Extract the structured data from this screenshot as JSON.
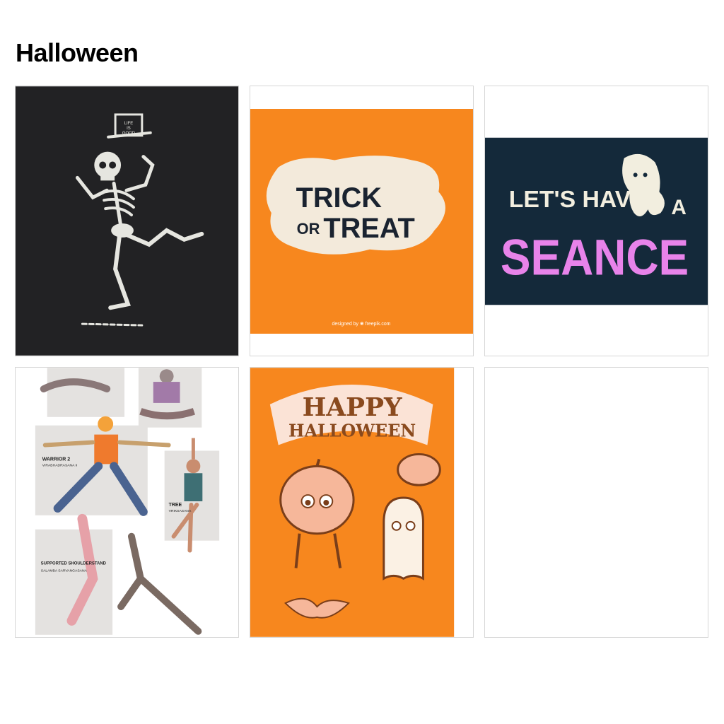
{
  "page": {
    "title": "Halloween"
  },
  "gallery": {
    "tiles": [
      {
        "artwork": "dancing-skeleton-top-hat",
        "hat_text": [
          "LIFE",
          "IS",
          "GOOD"
        ],
        "background": "#222224"
      },
      {
        "artwork": "trick-or-treat-lettering",
        "line1": "TRICK",
        "line2a": "OR",
        "line2b": "TREAT",
        "credit": "designed by ❀ freepik.com",
        "background": "#f7871e"
      },
      {
        "artwork": "lets-have-a-seance-ghost",
        "line1": "LET'S HAVE",
        "word_a": "A",
        "line2": "SEANCE",
        "background": "#14293a",
        "accent": "#e883ea"
      },
      {
        "artwork": "zombie-yoga-poses",
        "labels": [
          {
            "name": "WARRIOR 2",
            "sub": "VIRABHADRASANA II"
          },
          {
            "name": "TREE",
            "sub": "VRIKSASANA"
          },
          {
            "name": "SUPPORTED SHOULDERSTAND",
            "sub": "SALAMBA SARVANGASANA"
          }
        ]
      },
      {
        "artwork": "happy-halloween-retro-characters",
        "line1": "HAPPY",
        "line2": "HALLOWEEN",
        "background": "#f7871e"
      },
      {
        "artwork": "empty-placeholder"
      }
    ]
  }
}
